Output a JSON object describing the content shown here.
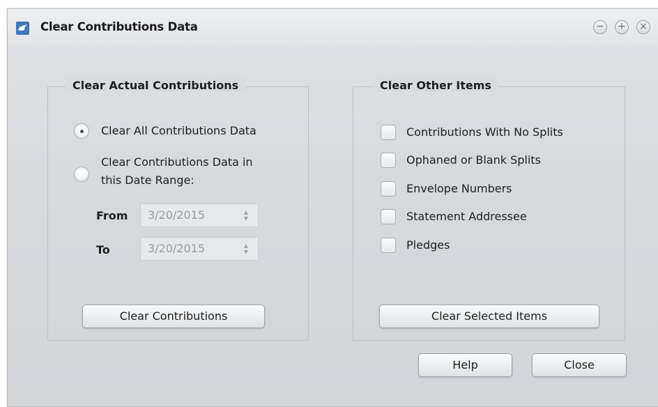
{
  "window": {
    "title": "Clear Contributions Data",
    "controls": {
      "minimize": "−",
      "maximize": "+",
      "close": "×"
    }
  },
  "clear_actual": {
    "title": "Clear Actual Contributions",
    "option_all": "Clear All Contributions Data",
    "option_range_line1": "Clear Contributions Data in",
    "option_range_line2": "this Date Range:",
    "selected_option": "all",
    "from_label": "From",
    "from_value": "3/20/2015",
    "to_label": "To",
    "to_value": "3/20/2015",
    "button": "Clear Contributions"
  },
  "clear_other": {
    "title": "Clear Other Items",
    "items": [
      {
        "label": "Contributions With No Splits",
        "checked": false
      },
      {
        "label": "Ophaned or Blank Splits",
        "checked": false
      },
      {
        "label": "Envelope Numbers",
        "checked": false
      },
      {
        "label": "Statement Addressee",
        "checked": false
      },
      {
        "label": "Pledges",
        "checked": false
      }
    ],
    "button": "Clear Selected Items"
  },
  "footer": {
    "help": "Help",
    "close": "Close"
  },
  "colors": {
    "window_bg": "#d8dcdf",
    "accent_icon": "#3d78b8"
  },
  "icons": {
    "app": "bird-logo-icon",
    "minimize": "minimize-icon",
    "maximize": "maximize-icon",
    "close": "close-icon",
    "spin": "spinner-arrows-icon"
  }
}
